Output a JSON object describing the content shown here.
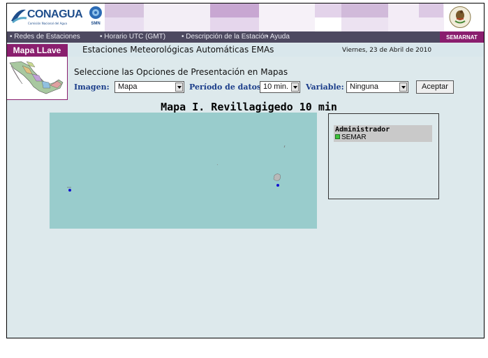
{
  "header": {
    "logo_text": "CONAGUA",
    "logo_subtext": "Comisión Nacional del Agua",
    "smn_text": "SMN",
    "semarnat": "SEMARNAT"
  },
  "nav": {
    "items": [
      "• Redes de Estaciones",
      "• Horario UTC (GMT)",
      "• Descripción de la Estación",
      "• Ayuda"
    ]
  },
  "key_map": {
    "title": "Mapa LLave"
  },
  "page": {
    "title": "Estaciones Meteorológicas Automáticas EMAs",
    "date": "Viernes, 23 de Abril de 2010",
    "options_heading": "Seleccione las Opciones de Presentación en Mapas"
  },
  "controls": {
    "imagen_label": "Imagen:",
    "imagen_value": "Mapa",
    "periodo_label": "Período de datos:",
    "periodo_value": "10 min.",
    "variable_label": "Variable:",
    "variable_value": "Ninguna",
    "aceptar_label": "Aceptar"
  },
  "map": {
    "title": "Mapa I. Revillagigedo 10 min"
  },
  "legend": {
    "title": "Administrador",
    "items": [
      {
        "label": "SEMAR",
        "color": "#3cc43c"
      }
    ]
  },
  "colors": {
    "nav_bg": "#4d4960",
    "accent": "#8a1e6e",
    "map_sea": "#99cccc",
    "label_blue": "#1b3d8a",
    "station_dot": "#1010d0"
  }
}
